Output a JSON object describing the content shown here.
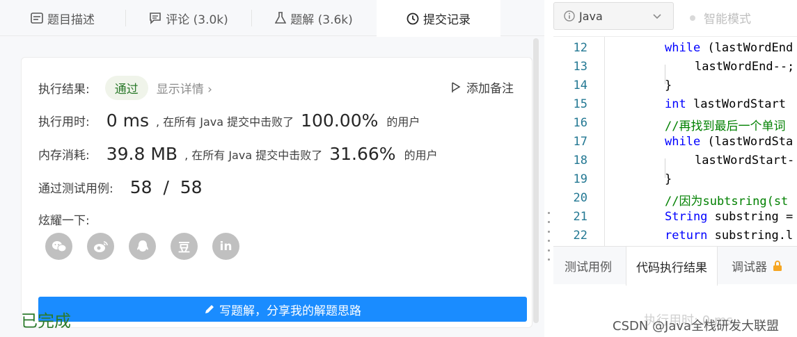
{
  "tabs": [
    {
      "label": "题目描述",
      "icon": "description-icon"
    },
    {
      "label": "评论 (3.0k)",
      "icon": "comment-icon"
    },
    {
      "label": "题解 (3.6k)",
      "icon": "flask-icon"
    },
    {
      "label": "提交记录",
      "icon": "clock-icon"
    }
  ],
  "result": {
    "exec_label": "执行结果:",
    "status": "通过",
    "details_link": "显示详情 ›",
    "add_note": "添加备注",
    "time_label": "执行用时:",
    "time_value": "0 ms",
    "time_text": ", 在所有 Java 提交中击败了",
    "time_pct": "100.00%",
    "time_suffix": "的用户",
    "mem_label": "内存消耗:",
    "mem_value": "39.8 MB",
    "mem_text": ", 在所有 Java 提交中击败了",
    "mem_pct": "31.66%",
    "mem_suffix": "的用户",
    "cases_label": "通过测试用例:",
    "cases_value": "58  /  58",
    "share_label": "炫耀一下:",
    "write_button": "写题解，分享我的解题思路"
  },
  "social": [
    {
      "name": "wechat-icon",
      "glyph": "✆"
    },
    {
      "name": "weibo-icon",
      "glyph": "◎"
    },
    {
      "name": "qq-icon",
      "glyph": "♟"
    },
    {
      "name": "douban-icon",
      "glyph": "豆"
    },
    {
      "name": "linkedin-icon",
      "glyph": "in"
    }
  ],
  "editor": {
    "language": "Java",
    "smart_mode": "智能模式",
    "lines": [
      {
        "n": "12",
        "indent": 0,
        "parts": [
          {
            "t": "while",
            "c": "kw"
          },
          {
            "t": " (lastWordEnd",
            "c": ""
          }
        ]
      },
      {
        "n": "13",
        "indent": 1,
        "parts": [
          {
            "t": "lastWordEnd--;",
            "c": ""
          }
        ]
      },
      {
        "n": "14",
        "indent": 0,
        "parts": [
          {
            "t": "}",
            "c": ""
          }
        ]
      },
      {
        "n": "15",
        "indent": 0,
        "parts": [
          {
            "t": "int",
            "c": "kw"
          },
          {
            "t": " lastWordStart ",
            "c": ""
          }
        ]
      },
      {
        "n": "16",
        "indent": 0,
        "parts": [
          {
            "t": "//再找到最后一个单词",
            "c": "cm"
          }
        ]
      },
      {
        "n": "17",
        "indent": 0,
        "parts": [
          {
            "t": "while",
            "c": "kw"
          },
          {
            "t": " (lastWordSta",
            "c": ""
          }
        ]
      },
      {
        "n": "18",
        "indent": 1,
        "parts": [
          {
            "t": "lastWordStart-",
            "c": ""
          }
        ]
      },
      {
        "n": "19",
        "indent": 0,
        "parts": [
          {
            "t": "}",
            "c": ""
          }
        ]
      },
      {
        "n": "20",
        "indent": 0,
        "parts": [
          {
            "t": "//因为subtsring(st",
            "c": "cm"
          }
        ]
      },
      {
        "n": "21",
        "indent": 0,
        "parts": [
          {
            "t": "String",
            "c": "kw"
          },
          {
            "t": " substring =",
            "c": ""
          }
        ]
      },
      {
        "n": "22",
        "indent": 0,
        "parts": [
          {
            "t": "return",
            "c": "kw"
          },
          {
            "t": " substring.l",
            "c": ""
          }
        ]
      }
    ]
  },
  "bottom_tabs": [
    {
      "label": "测试用例"
    },
    {
      "label": "代码执行结果"
    },
    {
      "label": "调试器"
    }
  ],
  "console": {
    "status": "已完成",
    "ghost": "执行用时: 0 ms"
  },
  "watermark": "CSDN @Java全栈研发大联盟"
}
